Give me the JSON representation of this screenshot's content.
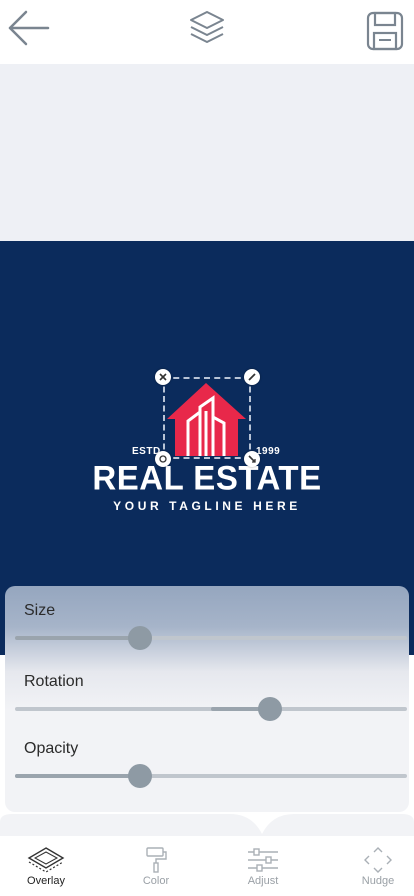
{
  "header": {
    "back_icon": "arrow-left-icon",
    "layers_icon": "layers-icon",
    "save_icon": "floppy-save-icon"
  },
  "canvas": {
    "background_color": "#0b2b5c",
    "logo": {
      "estd": "ESTD",
      "year": "1999",
      "brand": "REAL ESTATE",
      "tagline": "YOUR TAGLINE HERE",
      "house_color": "#e8284a"
    }
  },
  "controls": {
    "size": {
      "label": "Size",
      "value": 0.32
    },
    "rotation": {
      "label": "Rotation",
      "value": 0.65
    },
    "opacity": {
      "label": "Opacity",
      "value": 0.32
    }
  },
  "tabs": [
    {
      "label": "Overlay",
      "icon": "overlay-icon",
      "active": true
    },
    {
      "label": "Color",
      "icon": "paint-roller-icon",
      "active": false
    },
    {
      "label": "Adjust",
      "icon": "sliders-icon",
      "active": false
    },
    {
      "label": "Nudge",
      "icon": "nudge-arrows-icon",
      "active": false
    }
  ]
}
